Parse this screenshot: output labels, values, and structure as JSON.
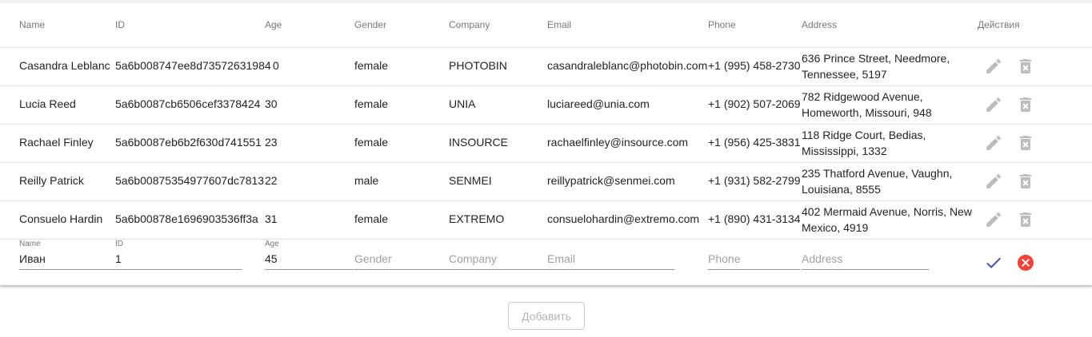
{
  "columns": [
    "Name",
    "ID",
    "Age",
    "Gender",
    "Company",
    "Email",
    "Phone",
    "Address",
    "Действия"
  ],
  "rows": [
    {
      "name": "Casandra Leblanc",
      "id": "5a6b008747ee8d73572631984",
      "age": "0",
      "gender": "female",
      "company": "PHOTOBIN",
      "email": "casandraleblanc@photobin.com",
      "phone": "+1 (995) 458-2730",
      "address": "636 Prince Street, Needmore, Tennessee, 5197"
    },
    {
      "name": "Lucia Reed",
      "id": "5a6b0087cb6506cef3378424",
      "age": "30",
      "gender": "female",
      "company": "UNIA",
      "email": "luciareed@unia.com",
      "phone": "+1 (902) 507-2069",
      "address": "782 Ridgewood Avenue, Homeworth, Missouri, 948"
    },
    {
      "name": "Rachael Finley",
      "id": "5a6b0087eb6b2f630d741551",
      "age": "23",
      "gender": "female",
      "company": "INSOURCE",
      "email": "rachaelfinley@insource.com",
      "phone": "+1 (956) 425-3831",
      "address": "118 Ridge Court, Bedias, Mississippi, 1332"
    },
    {
      "name": "Reilly Patrick",
      "id": "5a6b00875354977607dc7813",
      "age": "22",
      "gender": "male",
      "company": "SENMEI",
      "email": "reillypatrick@senmei.com",
      "phone": "+1 (931) 582-2799",
      "address": "235 Thatford Avenue, Vaughn, Louisiana, 8555"
    },
    {
      "name": "Consuelo Hardin",
      "id": "5a6b00878e1696903536ff3a",
      "age": "31",
      "gender": "female",
      "company": "EXTREMO",
      "email": "consuelohardin@extremo.com",
      "phone": "+1 (890) 431-3134",
      "address": "402 Mermaid Avenue, Norris, New Mexico, 4919"
    }
  ],
  "new_row": {
    "name_label": "Name",
    "name_value": "Иван",
    "id_label": "ID",
    "id_value": "1",
    "age_label": "Age",
    "age_value": "45",
    "gender_placeholder": "Gender",
    "company_placeholder": "Company",
    "email_placeholder": "Email",
    "phone_placeholder": "Phone",
    "address_placeholder": "Address"
  },
  "add_button_label": "Добавить",
  "icons": {
    "edit": "pencil-icon",
    "delete": "trash-icon",
    "confirm": "check-icon",
    "cancel": "cancel-circle-icon"
  },
  "colors": {
    "confirm": "#3f51b5",
    "cancel": "#f44336",
    "icon_gray": "#9e9e9e"
  }
}
